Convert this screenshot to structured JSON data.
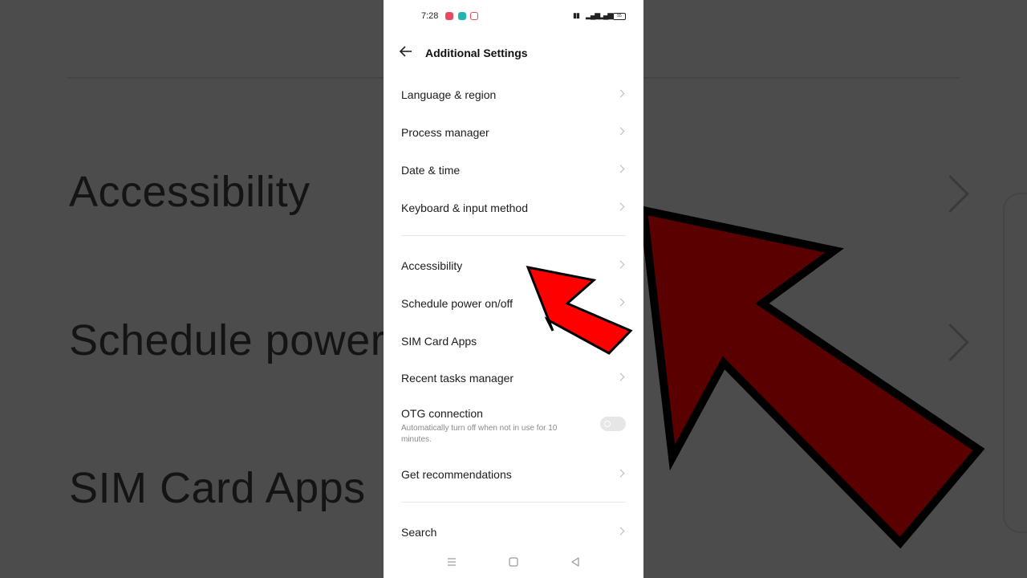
{
  "background": {
    "rows": [
      "Accessibility",
      "Schedule power",
      "SIM Card Apps"
    ]
  },
  "status_bar": {
    "time": "7:28",
    "battery": "55"
  },
  "header": {
    "title": "Additional Settings"
  },
  "settings": [
    {
      "label": "Language & region"
    },
    {
      "label": "Process manager"
    },
    {
      "label": "Date & time"
    },
    {
      "label": "Keyboard & input method"
    },
    {
      "label": "Accessibility"
    },
    {
      "label": "Schedule power on/off"
    },
    {
      "label": "SIM Card Apps"
    },
    {
      "label": "Recent tasks manager"
    },
    {
      "label": "OTG connection",
      "description": "Automatically turn off when not in use for 10 minutes.",
      "toggle": false
    },
    {
      "label": "Get recommendations"
    },
    {
      "label": "Search"
    }
  ],
  "icons": {
    "back": "arrow-left-icon",
    "nav_menu": "menu-icon",
    "nav_home": "square-icon",
    "nav_back": "triangle-back-icon"
  },
  "colors": {
    "arrow_fill": "#ff0000",
    "big_arrow_fill": "#5a0000",
    "background": "#4c4c4c",
    "screen": "#ffffff"
  }
}
